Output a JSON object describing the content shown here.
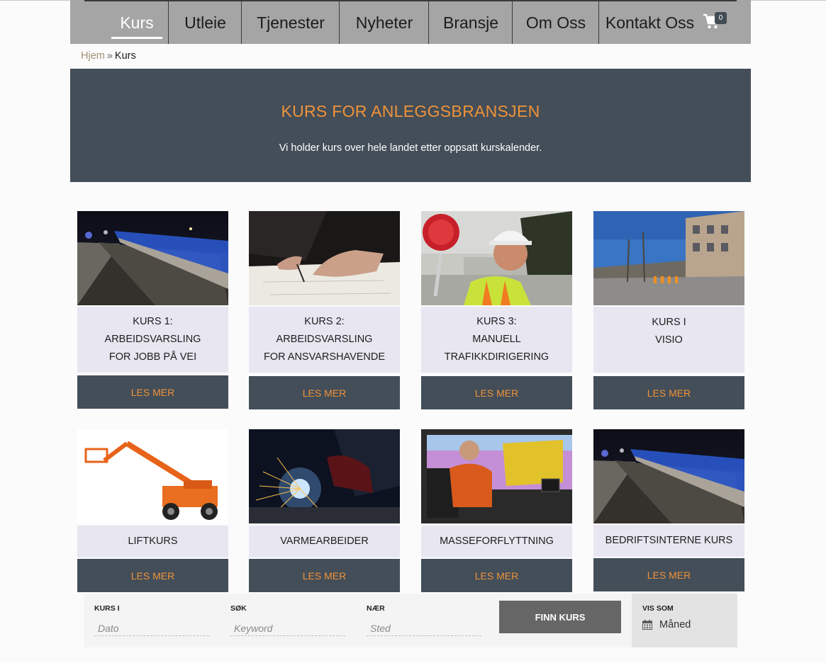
{
  "nav": {
    "items": [
      {
        "label": "Kurs"
      },
      {
        "label": "Utleie"
      },
      {
        "label": "Tjenester"
      },
      {
        "label": "Nyheter"
      },
      {
        "label": "Bransje"
      },
      {
        "label": "Om Oss"
      },
      {
        "label": "Kontakt Oss"
      }
    ],
    "active": "Kurs",
    "cart_icon": "shopping-cart-icon",
    "cart_count": "0"
  },
  "breadcrumb": {
    "home": "Hjem",
    "separator": "»",
    "current": "Kurs"
  },
  "hero": {
    "title": "KURS FOR ANLEGGSBRANSJEN",
    "subtitle": "Vi holder kurs over hele landet etter oppsatt kurskalender."
  },
  "courses": [
    {
      "lines": [
        "KURS 1:",
        "ARBEIDSVARSLING",
        "FOR JOBB PÅ VEI"
      ],
      "button": "LES MER",
      "image": "night-road-barrier"
    },
    {
      "lines": [
        "KURS 2:",
        "ARBEIDSVARSLING",
        "FOR ANSVARSHAVENDE"
      ],
      "button": "LES MER",
      "image": "hand-signing-document"
    },
    {
      "lines": [
        "KURS 3:",
        "MANUELL",
        "TRAFIKKDIRIGERING"
      ],
      "button": "LES MER",
      "image": "worker-with-stop-sign"
    },
    {
      "lines": [
        "KURS I",
        "VISIO"
      ],
      "button": "LES MER",
      "image": "city-street-roadwork"
    },
    {
      "lines": [
        "LIFTKURS"
      ],
      "button": "LES MER",
      "image": "boom-lift"
    },
    {
      "lines": [
        "VARMEARBEIDER"
      ],
      "button": "LES MER",
      "image": "welding-sparks"
    },
    {
      "lines": [
        "MASSEFORFLYTTNING"
      ],
      "button": "LES MER",
      "image": "excavator-simulator"
    },
    {
      "lines": [
        "BEDRIFTSINTERNE KURS"
      ],
      "button": "LES MER",
      "image": "night-road-barrier"
    }
  ],
  "search": {
    "fields": [
      {
        "label": "KURS I",
        "placeholder": "Dato"
      },
      {
        "label": "SØK",
        "placeholder": "Keyword"
      },
      {
        "label": "NÆR",
        "placeholder": "Sted"
      }
    ],
    "button": "FINN KURS",
    "view_label": "VIS SOM",
    "view_value": "Måned",
    "view_icon": "calendar-icon"
  },
  "colors": {
    "accent": "#f0923a",
    "dark": "#434e58",
    "nav_bg": "#a5a5a5",
    "card_label_bg": "#e8e6f0",
    "breadcrumb_link": "#a48f70"
  }
}
